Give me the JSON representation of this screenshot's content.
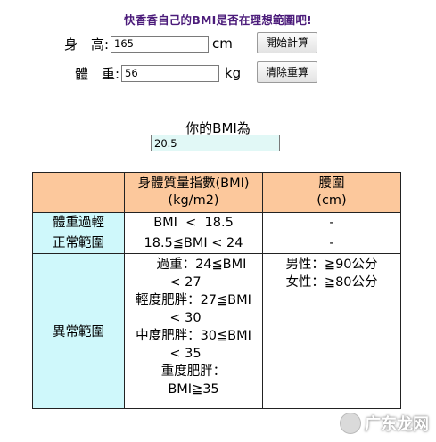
{
  "headline": "快香香自己的BMI是否在理想範圍吧!",
  "height_row": {
    "label": "身　高:",
    "value": "165",
    "unit": "cm"
  },
  "weight_row": {
    "label": "體　重:",
    "value": "56",
    "unit": "kg"
  },
  "buttons": {
    "calculate": "開始計算",
    "clear": "清除重算"
  },
  "result": {
    "label": "你的BMI為",
    "value": "20.5"
  },
  "table": {
    "headers": [
      "",
      "身體質量指數(BMI)",
      "(kg/m2)",
      "腰圍",
      "(cm)"
    ],
    "rows": [
      {
        "category": "體重過輕",
        "bmi": "BMI  <  18.5",
        "waist": "-"
      },
      {
        "category": "正常範圍",
        "bmi": "18.5≦BMI < 24",
        "waist": "-"
      }
    ],
    "abnormal": {
      "category": "異常範圍",
      "bmi_lines": [
        "過重：24≦BMI",
        "< 27",
        "輕度肥胖：27≦BMI",
        "< 30",
        "中度肥胖：30≦BMI",
        "< 35",
        "重度肥胖：",
        "BMI≧35"
      ],
      "waist_lines": [
        "男性：≧90公分",
        "女性：≧80公分"
      ]
    }
  },
  "watermark": "广东龙网"
}
